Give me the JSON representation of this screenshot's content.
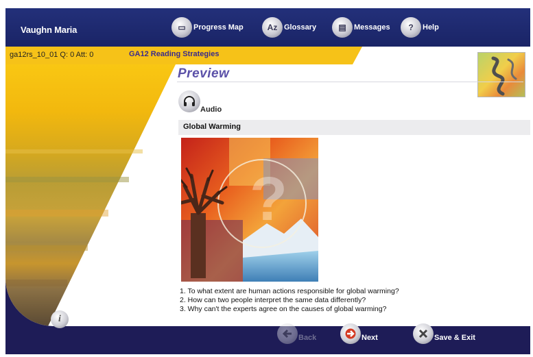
{
  "header": {
    "user_name": "Vaughn Maria",
    "nav": [
      {
        "label": "Progress Map",
        "icon": "progress-map-icon",
        "glyph": "▭"
      },
      {
        "label": "Glossary",
        "icon": "glossary-icon",
        "glyph": "Az"
      },
      {
        "label": "Messages",
        "icon": "messages-icon",
        "glyph": "▤"
      },
      {
        "label": "Help",
        "icon": "help-icon",
        "glyph": "?"
      }
    ]
  },
  "course": {
    "code": "ga12rs_10_01 Q: 0 Att: 0",
    "title": "GA12 Reading Strategies"
  },
  "content": {
    "section_heading": "Preview",
    "audio_label": "Audio",
    "topic_title": "Global Warming",
    "questions": [
      "1. To what extent are human actions responsible for global warming?",
      "2. How can two people interpret the same data differently?",
      "3. Why can't the experts agree on the causes of global warming?"
    ]
  },
  "footer": {
    "back_label": "Back",
    "next_label": "Next",
    "save_exit_label": "Save & Exit"
  },
  "colors": {
    "header_bg": "#1e2a6e",
    "accent_yellow": "#f6c218",
    "heading_purple": "#5b51a8",
    "next_red": "#d43a22"
  }
}
